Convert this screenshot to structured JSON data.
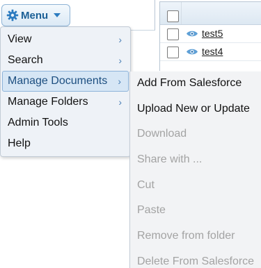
{
  "toolbar": {
    "menu_label": "Menu",
    "menu_icon": "gear-icon"
  },
  "file_list": {
    "rows": [
      {
        "name": "test5"
      },
      {
        "name": "test4"
      }
    ]
  },
  "menu": {
    "items": [
      {
        "label": "View",
        "has_submenu": true
      },
      {
        "label": "Search",
        "has_submenu": true
      },
      {
        "label": "Manage Documents",
        "has_submenu": true,
        "active": true
      },
      {
        "label": "Manage Folders",
        "has_submenu": true
      },
      {
        "label": "Admin Tools",
        "has_submenu": false
      },
      {
        "label": "Help",
        "has_submenu": false
      }
    ],
    "chevron": "›"
  },
  "submenu": {
    "items": [
      {
        "label": "Add From Salesforce",
        "enabled": true
      },
      {
        "label": "Upload New or Update",
        "enabled": true
      },
      {
        "label": "Download",
        "enabled": false
      },
      {
        "label": "Share with ...",
        "enabled": false
      },
      {
        "label": "Cut",
        "enabled": false
      },
      {
        "label": "Paste",
        "enabled": false
      },
      {
        "label": "Remove from folder",
        "enabled": false
      },
      {
        "label": "Delete From Salesforce",
        "enabled": false
      }
    ]
  },
  "colors": {
    "accent": "#1b5f96",
    "menu_bg": "#eef2f7",
    "active_bg": "#d6e6f5",
    "disabled_text": "#a3a3a3"
  }
}
